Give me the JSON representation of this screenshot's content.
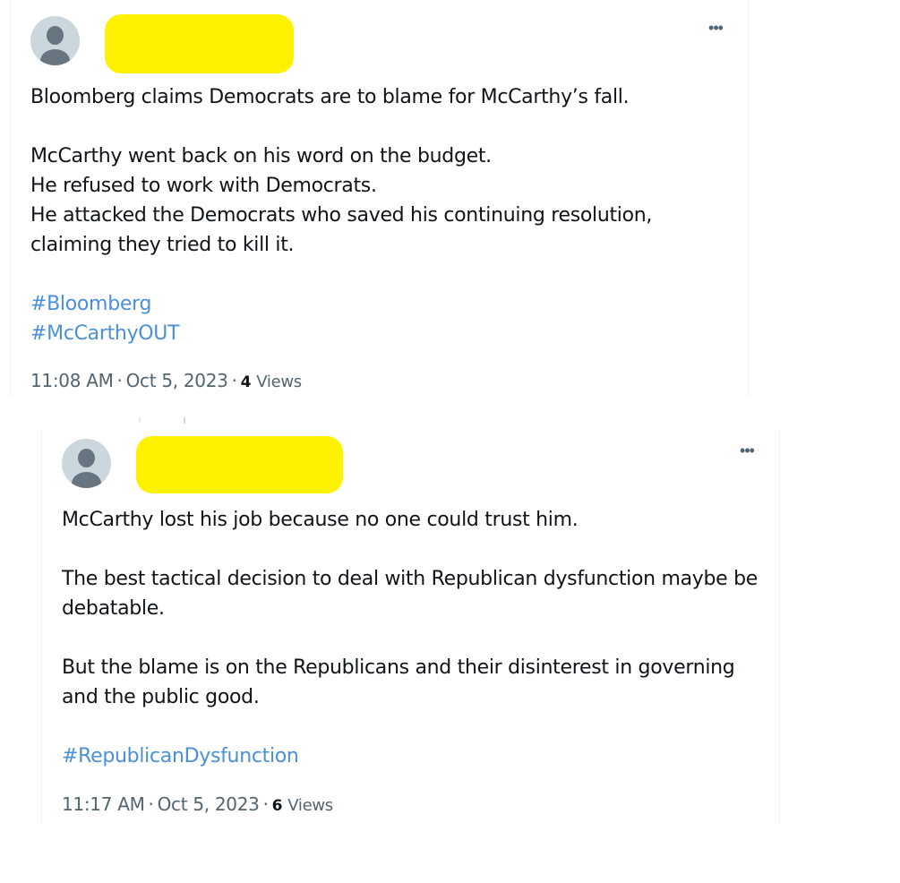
{
  "tweets": [
    {
      "body": "Bloomberg claims Democrats are to blame for McCarthy’s fall.\n\nMcCarthy  went back on his word on the budget.\nHe refused to work with Democrats.\nHe attacked the Democrats who saved his continuing resolution,\nclaiming they tried to kill it.",
      "hashtags": [
        "#Bloomberg",
        "#McCarthyOUT"
      ],
      "time": "11:08 AM",
      "date": "Oct 5, 2023",
      "view_count": "4",
      "views_label": "Views",
      "separator": "·",
      "more_icon": "more-horizontal-icon",
      "more_glyph": "•••"
    },
    {
      "body": "McCarthy lost his job because no one could trust him.\n\nThe best tactical decision to deal with Republican dysfunction maybe be debatable.\n\nBut the blame is on the Republicans and their disinterest in governing and the public good.",
      "hashtags": [
        "#RepublicanDysfunction"
      ],
      "time": "11:17 AM",
      "date": "Oct 5, 2023",
      "view_count": "6",
      "views_label": "Views",
      "separator": "·",
      "more_icon": "more-horizontal-icon",
      "more_glyph": "•••"
    }
  ],
  "colors": {
    "hashtag": "#4a90d9",
    "redaction": "#fff200",
    "avatar_bg": "#ccd6dd",
    "avatar_fg": "#66757f",
    "muted": "#536471"
  }
}
